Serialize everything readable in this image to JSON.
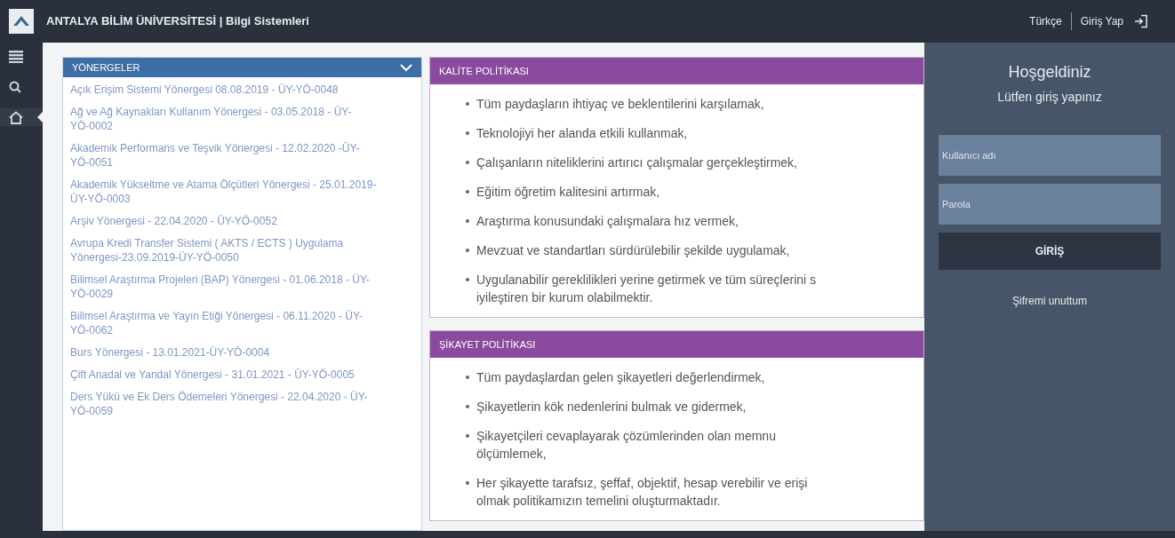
{
  "header": {
    "title": "ANTALYA BİLİM ÜNİVERSİTESİ | Bilgi Sistemleri",
    "language": "Türkçe",
    "login_link": "Giriş Yap"
  },
  "rail": [
    {
      "kind": "menu",
      "selected": false
    },
    {
      "kind": "search",
      "selected": false
    },
    {
      "kind": "home",
      "selected": true
    }
  ],
  "directives": {
    "title": "YÖNERGELER",
    "expanded": true,
    "items": [
      "Açık Erişim Sistemi Yönergesi 08.08.2019 - ÜY-YÖ-0048",
      "Ağ ve Ağ Kaynakları Kullanım Yönergesi - 03.05.2018 - ÜY-YÖ-0002",
      "Akademik Performans ve Teşvik Yönergesi - 12.02.2020 -ÜY-YÖ-0051",
      "Akademik Yükseltme ve Atama Ölçütleri Yönergesi - 25.01.2019-ÜY-YÖ-0003",
      "Arşiv Yönergesi - 22.04.2020 - ÜY-YÖ-0052",
      "Avrupa Kredi Transfer Sistemi ( AKTS / ECTS ) Uygulama Yönergesi-23.09.2019-ÜY-YÖ-0050",
      "Bilimsel Araştırma Projeleri (BAP) Yönergesi - 01.06.2018 - ÜY-YÖ-0029",
      "Bilimsel Araştırma ve Yayın Etiği Yönergesi - 06.11.2020 - ÜY-YÖ-0062",
      "Burs Yönergesi - 13.01.2021-ÜY-YÖ-0004",
      "Çift Anadal ve Yandal Yönergesi - 31.01.2021 - ÜY-YÖ-0005",
      "Ders Yükü ve Ek Ders Ödemeleri Yönergesi - 22.04.2020 - ÜY-YÖ-0059"
    ]
  },
  "policies": [
    {
      "title": "KALİTE POLİTİKASI",
      "items": [
        [
          "Tüm paydaşların ihtiyaç ve beklentilerini karşılamak,"
        ],
        [
          "Teknolojiyi her alanda etkili kullanmak,"
        ],
        [
          "Çalışanların niteliklerini artırıcı çalışmalar gerçekleştirmek,"
        ],
        [
          "Eğitim öğretim kalitesini artırmak,"
        ],
        [
          "Araştırma konusundaki çalışmalara hız vermek,"
        ],
        [
          "Mevzuat ve standartları sürdürülebilir şekilde uygulamak,"
        ],
        [
          "Uygulanabilir gereklilikleri yerine getirmek ve tüm süreçlerini s",
          "iyileştiren bir kurum olabilmektir."
        ]
      ]
    },
    {
      "title": "ŞİKAYET POLİTİKASI",
      "items": [
        [
          "Tüm paydaşlardan gelen şikayetleri değerlendirmek,"
        ],
        [
          "Şikayetlerin kök nedenlerini bulmak ve gidermek,"
        ],
        [
          "Şikayetçileri cevaplayarak çözümlerinden olan memnu",
          "ölçümlemek,"
        ],
        [
          "Her şikayette tarafsız, şeffaf, objektif, hesap verebilir ve erişi",
          "olmak politikamızın temelini oluşturmaktadır."
        ]
      ]
    }
  ],
  "login": {
    "welcome": "Hoşgeldiniz",
    "prompt": "Lütfen giriş yapınız",
    "username_placeholder": "Kullanıcı adı",
    "password_placeholder": "Parola",
    "submit": "GİRİŞ",
    "forgot": "Şifremi unuttum"
  }
}
